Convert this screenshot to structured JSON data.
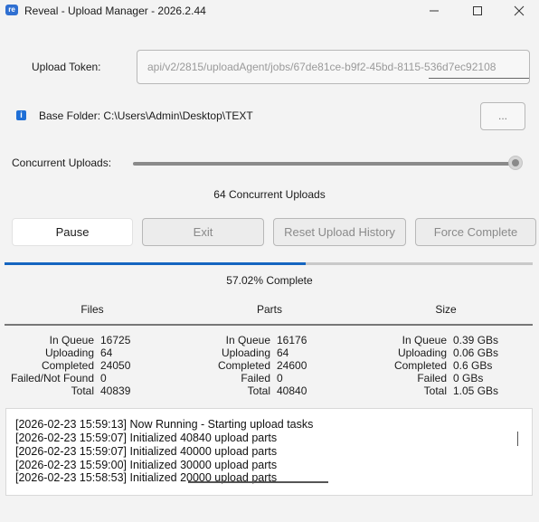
{
  "window": {
    "title": "Reveal - Upload Manager - 2026.2.44",
    "app_icon_text": "re",
    "controls": [
      "minimize",
      "maximize",
      "close"
    ]
  },
  "token": {
    "label": "Upload Token:",
    "value": "api/v2/2815/uploadAgent/jobs/67de81ce-b9f2-45bd-8115-536d7ec92108"
  },
  "folder": {
    "label": "Base Folder: C:\\Users\\Admin\\Desktop\\TEXT",
    "browse_label": "..."
  },
  "concurrency": {
    "label": "Concurrent Uploads:",
    "value_text": "64 Concurrent Uploads",
    "slider_level": 1.0
  },
  "buttons": {
    "pause": "Pause",
    "exit": "Exit",
    "reset": "Reset Upload History",
    "force": "Force Complete"
  },
  "progress": {
    "percent": 57.02,
    "text": "57.02% Complete",
    "fill_color": "#1565c0"
  },
  "columns": [
    "Files",
    "Parts",
    "Size"
  ],
  "files": [
    {
      "k": "In Queue",
      "v": "16725"
    },
    {
      "k": "Uploading",
      "v": "64"
    },
    {
      "k": "Completed",
      "v": "24050"
    },
    {
      "k": "Failed/Not Found",
      "v": "0"
    },
    {
      "k": "Total",
      "v": "40839"
    }
  ],
  "parts": [
    {
      "k": "In Queue",
      "v": "16176"
    },
    {
      "k": "Uploading",
      "v": "64"
    },
    {
      "k": "Completed",
      "v": "24600"
    },
    {
      "k": "Failed",
      "v": "0"
    },
    {
      "k": "Total",
      "v": "40840"
    }
  ],
  "size": [
    {
      "k": "In Queue",
      "v": "0.39 GBs"
    },
    {
      "k": "Uploading",
      "v": "0.06 GBs"
    },
    {
      "k": "Completed",
      "v": "0.6 GBs"
    },
    {
      "k": "Failed",
      "v": "0 GBs"
    },
    {
      "k": "Total",
      "v": "1.05 GBs"
    }
  ],
  "log": [
    "[2026-02-23 15:59:13] Now Running - Starting upload tasks",
    "[2026-02-23 15:59:07] Initialized 40840 upload parts",
    "[2026-02-23 15:59:07] Initialized 40000 upload parts",
    "[2026-02-23 15:59:00] Initialized 30000 upload parts",
    "[2026-02-23 15:58:53] Initialized 20000 upload parts"
  ]
}
